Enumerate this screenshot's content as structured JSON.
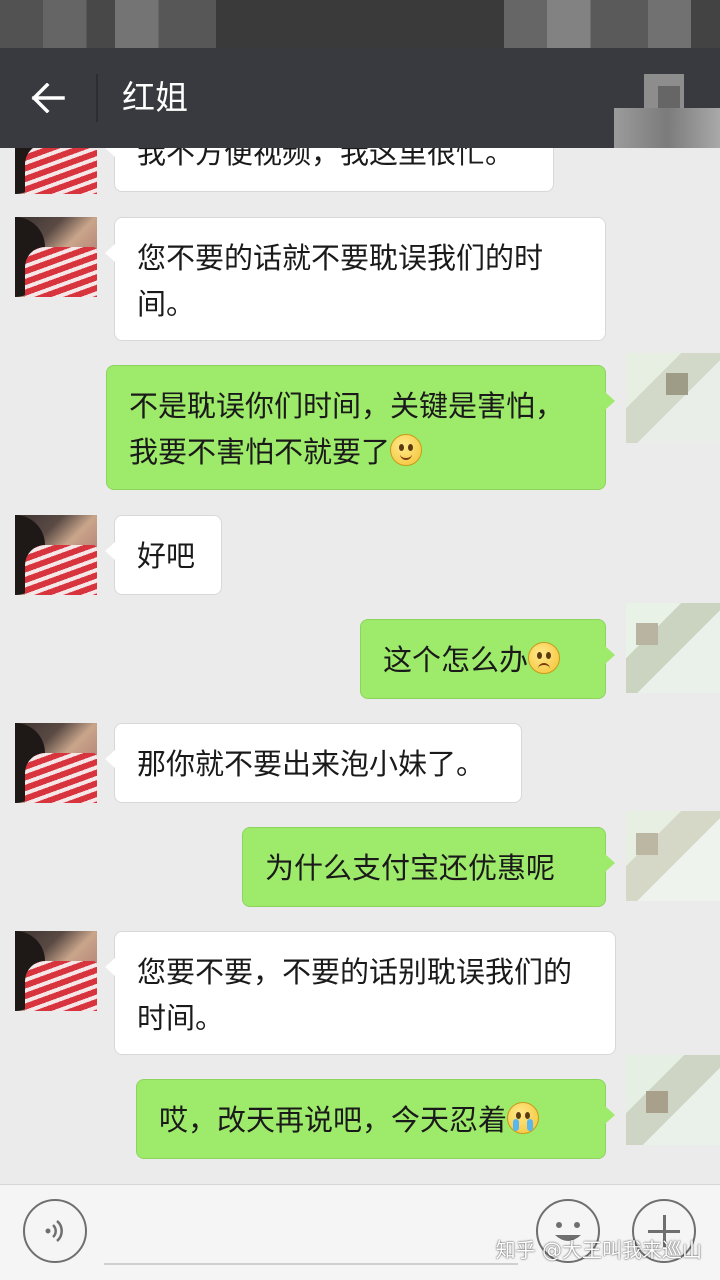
{
  "header": {
    "title": "红姐"
  },
  "messages": [
    {
      "side": "in",
      "text": "我不方便视频，我这里很忙。"
    },
    {
      "side": "in",
      "text": "您不要的话就不要耽误我们的时间。"
    },
    {
      "side": "out",
      "text": "不是耽误你们时间，关键是害怕，我要不害怕不就要了",
      "emoji": "smile-emoji"
    },
    {
      "side": "in",
      "text": "好吧"
    },
    {
      "side": "out",
      "text": "这个怎么办",
      "emoji": "worried-emoji"
    },
    {
      "side": "in",
      "text": "那你就不要出来泡小妹了。"
    },
    {
      "side": "out",
      "text": "为什么支付宝还优惠呢"
    },
    {
      "side": "in",
      "text": "您要不要，不要的话别耽误我们的时间。"
    },
    {
      "side": "out",
      "text": "哎，改天再说吧，今天忍着",
      "emoji": "crying-emoji"
    }
  ],
  "watermark": "知乎 @大王叫我来巡山",
  "icons": {
    "back": "arrow-left-icon",
    "voice": "voice-icon",
    "emoji": "emoji-face-icon",
    "more": "plus-icon"
  },
  "colors": {
    "header_bg": "#393a3f",
    "chat_bg": "#ebebeb",
    "outgoing_bubble": "#9eea6a",
    "incoming_bubble": "#ffffff"
  }
}
